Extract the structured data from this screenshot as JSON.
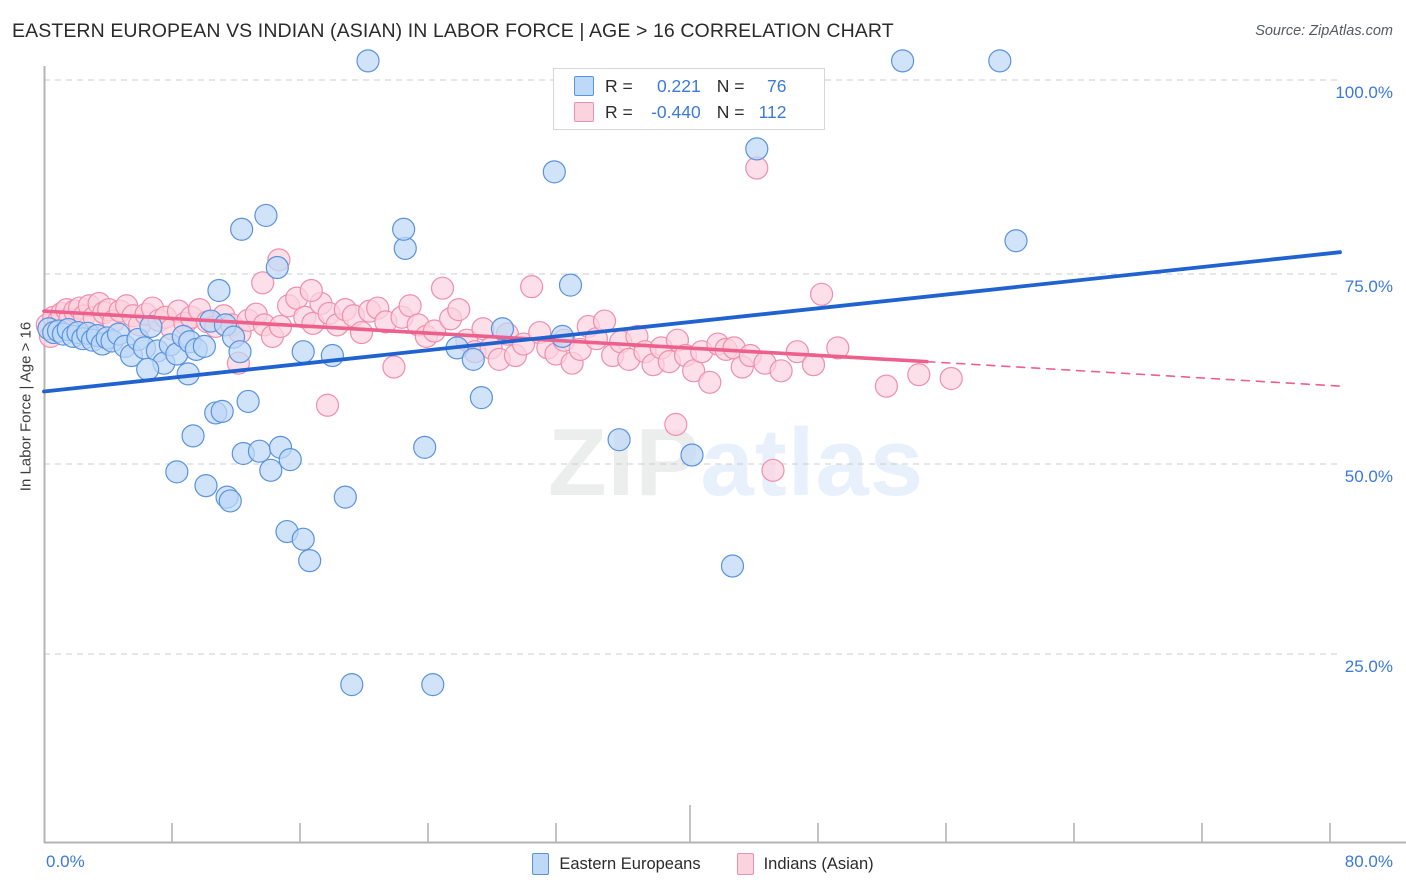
{
  "header": {
    "title": "EASTERN EUROPEAN VS INDIAN (ASIAN) IN LABOR FORCE | AGE > 16 CORRELATION CHART",
    "source": "Source: ZipAtlas.com"
  },
  "watermark": {
    "part1": "ZIP",
    "part2": "atlas"
  },
  "stats_legend": {
    "blue": {
      "r_label": "R =",
      "r_value": "0.221",
      "n_label": "N =",
      "n_value": "76"
    },
    "pink": {
      "r_label": "R =",
      "r_value": "-0.440",
      "n_label": "N =",
      "n_value": "112"
    }
  },
  "bottom_legend": {
    "series1": "Eastern Europeans",
    "series2": "Indians (Asian)"
  },
  "axes": {
    "ylabel": "In Labor Force | Age > 16",
    "y_ticks": [
      "100.0%",
      "75.0%",
      "50.0%",
      "25.0%"
    ],
    "x_min_label": "0.0%",
    "x_max_label": "80.0%"
  },
  "colors": {
    "blue_fill": "#bed8f7",
    "blue_stroke": "#5a93dd",
    "pink_fill": "#fbd3df",
    "pink_stroke": "#ef8fad",
    "blue_line": "#1f62d0",
    "pink_line": "#ed5f8d",
    "tick_text": "#3b7ad9",
    "grid": "#cccccc"
  },
  "chart_data": {
    "type": "scatter",
    "title": "EASTERN EUROPEAN VS INDIAN (ASIAN) IN LABOR FORCE | AGE > 16 CORRELATION CHART",
    "xlabel": "",
    "ylabel": "In Labor Force | Age > 16",
    "xlim": [
      0,
      80
    ],
    "ylim": [
      10.5,
      104.5
    ],
    "x_ticks": [
      0,
      80
    ],
    "y_ticks": [
      25,
      50,
      75,
      100
    ],
    "grid": true,
    "legend_position": "bottom-center",
    "series": [
      {
        "name": "Eastern Europeans",
        "color": "#bed8f7",
        "r": 0.221,
        "n": 76,
        "trend": {
          "x0": 0,
          "y0": 59.3,
          "x1": 80,
          "y1": 77.5,
          "style": "solid",
          "color": "#1f62d0"
        },
        "points": [
          [
            0.3,
            67.5
          ],
          [
            0.6,
            67.0
          ],
          [
            0.9,
            67.2
          ],
          [
            1.2,
            66.8
          ],
          [
            1.5,
            67.4
          ],
          [
            1.8,
            66.5
          ],
          [
            2.1,
            67.0
          ],
          [
            2.4,
            66.2
          ],
          [
            2.7,
            66.9
          ],
          [
            3.0,
            66.0
          ],
          [
            3.3,
            66.6
          ],
          [
            3.6,
            65.5
          ],
          [
            3.9,
            66.3
          ],
          [
            4.2,
            65.9
          ],
          [
            4.6,
            66.8
          ],
          [
            5.0,
            65.2
          ],
          [
            5.4,
            64.0
          ],
          [
            5.8,
            66.1
          ],
          [
            6.2,
            65.0
          ],
          [
            6.6,
            67.8
          ],
          [
            7.0,
            64.6
          ],
          [
            7.4,
            63.0
          ],
          [
            7.8,
            65.4
          ],
          [
            8.2,
            64.2
          ],
          [
            8.6,
            66.5
          ],
          [
            9.0,
            65.8
          ],
          [
            9.4,
            64.8
          ],
          [
            9.9,
            65.2
          ],
          [
            6.4,
            62.2
          ],
          [
            8.9,
            61.6
          ],
          [
            10.3,
            68.5
          ],
          [
            10.8,
            72.5
          ],
          [
            11.2,
            68.0
          ],
          [
            11.7,
            66.4
          ],
          [
            12.1,
            64.5
          ],
          [
            12.6,
            58.0
          ],
          [
            9.2,
            53.5
          ],
          [
            8.2,
            48.8
          ],
          [
            10.0,
            47.0
          ],
          [
            11.3,
            45.5
          ],
          [
            11.5,
            45.0
          ],
          [
            10.6,
            56.5
          ],
          [
            11.0,
            56.7
          ],
          [
            12.3,
            51.2
          ],
          [
            13.3,
            51.5
          ],
          [
            14.0,
            49.0
          ],
          [
            14.6,
            52.0
          ],
          [
            15.2,
            50.4
          ],
          [
            15.0,
            41.0
          ],
          [
            16.0,
            40.0
          ],
          [
            16.4,
            37.2
          ],
          [
            13.7,
            82.3
          ],
          [
            12.2,
            80.5
          ],
          [
            14.4,
            75.5
          ],
          [
            16.0,
            64.5
          ],
          [
            17.8,
            64.0
          ],
          [
            18.6,
            45.5
          ],
          [
            19.0,
            21.0
          ],
          [
            20.0,
            102.5
          ],
          [
            22.3,
            78.0
          ],
          [
            22.2,
            80.5
          ],
          [
            24.0,
            21.0
          ],
          [
            23.5,
            52.0
          ],
          [
            25.5,
            65.0
          ],
          [
            26.5,
            63.5
          ],
          [
            27.0,
            58.5
          ],
          [
            28.3,
            67.5
          ],
          [
            31.5,
            88.0
          ],
          [
            32.5,
            73.2
          ],
          [
            32.0,
            66.5
          ],
          [
            35.5,
            53.0
          ],
          [
            40.0,
            51.0
          ],
          [
            42.5,
            36.5
          ],
          [
            44.0,
            91.0
          ],
          [
            53.0,
            102.5
          ],
          [
            59.0,
            102.5
          ],
          [
            60.0,
            79.0
          ]
        ]
      },
      {
        "name": "Indians (Asian)",
        "color": "#fbd3df",
        "r": -0.44,
        "n": 112,
        "trend": {
          "x0": 0,
          "y0": 69.8,
          "x1": 54.5,
          "y1": 63.2,
          "style": "solid",
          "color": "#ed5f8d",
          "dashed_from": {
            "x0": 54.5,
            "y0": 63.2,
            "x1": 80,
            "y1": 60.0
          }
        },
        "points": [
          [
            0.2,
            68.0
          ],
          [
            0.4,
            66.5
          ],
          [
            0.6,
            69.0
          ],
          [
            0.9,
            68.5
          ],
          [
            1.1,
            69.5
          ],
          [
            1.4,
            70.0
          ],
          [
            1.6,
            68.8
          ],
          [
            1.9,
            69.8
          ],
          [
            2.2,
            70.2
          ],
          [
            2.5,
            69.2
          ],
          [
            2.8,
            70.5
          ],
          [
            3.1,
            69.0
          ],
          [
            3.4,
            70.8
          ],
          [
            3.7,
            69.6
          ],
          [
            4.0,
            70.0
          ],
          [
            4.3,
            68.5
          ],
          [
            4.7,
            69.8
          ],
          [
            5.1,
            70.5
          ],
          [
            5.5,
            69.2
          ],
          [
            5.9,
            68.0
          ],
          [
            6.3,
            69.4
          ],
          [
            6.7,
            70.2
          ],
          [
            7.1,
            68.6
          ],
          [
            7.5,
            69.0
          ],
          [
            7.9,
            67.5
          ],
          [
            8.3,
            69.8
          ],
          [
            8.7,
            68.2
          ],
          [
            9.1,
            69.0
          ],
          [
            9.6,
            70.0
          ],
          [
            10.1,
            68.4
          ],
          [
            10.6,
            67.8
          ],
          [
            11.1,
            69.2
          ],
          [
            11.6,
            68.0
          ],
          [
            12.1,
            67.0
          ],
          [
            12.6,
            68.6
          ],
          [
            13.1,
            69.4
          ],
          [
            13.6,
            68.0
          ],
          [
            14.1,
            66.5
          ],
          [
            14.6,
            67.8
          ],
          [
            15.1,
            70.5
          ],
          [
            15.6,
            71.5
          ],
          [
            16.1,
            69.0
          ],
          [
            16.6,
            68.2
          ],
          [
            17.1,
            70.8
          ],
          [
            17.6,
            69.5
          ],
          [
            18.1,
            68.0
          ],
          [
            18.6,
            70.0
          ],
          [
            19.1,
            69.2
          ],
          [
            19.6,
            67.0
          ],
          [
            20.1,
            69.8
          ],
          [
            20.6,
            70.2
          ],
          [
            21.1,
            68.4
          ],
          [
            21.6,
            62.5
          ],
          [
            13.5,
            73.5
          ],
          [
            14.5,
            76.5
          ],
          [
            16.5,
            72.5
          ],
          [
            12.0,
            63.0
          ],
          [
            17.5,
            57.5
          ],
          [
            22.1,
            69.0
          ],
          [
            22.6,
            70.5
          ],
          [
            23.1,
            68.0
          ],
          [
            23.6,
            66.5
          ],
          [
            24.1,
            67.2
          ],
          [
            24.6,
            72.8
          ],
          [
            25.1,
            68.8
          ],
          [
            25.6,
            70.0
          ],
          [
            26.1,
            66.0
          ],
          [
            26.6,
            64.5
          ],
          [
            27.1,
            67.5
          ],
          [
            27.6,
            65.0
          ],
          [
            28.1,
            63.5
          ],
          [
            28.6,
            66.8
          ],
          [
            29.1,
            64.0
          ],
          [
            29.6,
            65.5
          ],
          [
            30.1,
            73.0
          ],
          [
            30.6,
            67.0
          ],
          [
            31.1,
            65.0
          ],
          [
            31.6,
            64.2
          ],
          [
            32.1,
            66.0
          ],
          [
            32.6,
            63.0
          ],
          [
            33.1,
            64.8
          ],
          [
            33.6,
            67.8
          ],
          [
            34.1,
            66.2
          ],
          [
            34.6,
            68.5
          ],
          [
            35.1,
            64.0
          ],
          [
            35.6,
            65.8
          ],
          [
            36.1,
            63.5
          ],
          [
            36.6,
            66.5
          ],
          [
            37.1,
            64.5
          ],
          [
            37.6,
            62.8
          ],
          [
            38.1,
            65.0
          ],
          [
            38.6,
            63.2
          ],
          [
            39.1,
            66.0
          ],
          [
            39.6,
            64.0
          ],
          [
            39.0,
            55.0
          ],
          [
            40.1,
            62.0
          ],
          [
            40.6,
            64.5
          ],
          [
            41.1,
            60.5
          ],
          [
            41.6,
            65.5
          ],
          [
            42.1,
            64.8
          ],
          [
            42.6,
            65.0
          ],
          [
            43.1,
            62.5
          ],
          [
            43.6,
            64.0
          ],
          [
            44.0,
            88.5
          ],
          [
            44.5,
            63.0
          ],
          [
            45.0,
            49.0
          ],
          [
            45.5,
            62.0
          ],
          [
            46.5,
            64.5
          ],
          [
            47.5,
            62.8
          ],
          [
            48.0,
            72.0
          ],
          [
            49.0,
            65.0
          ],
          [
            52.0,
            60.0
          ],
          [
            54.0,
            61.5
          ],
          [
            56.0,
            61.0
          ]
        ]
      }
    ]
  }
}
